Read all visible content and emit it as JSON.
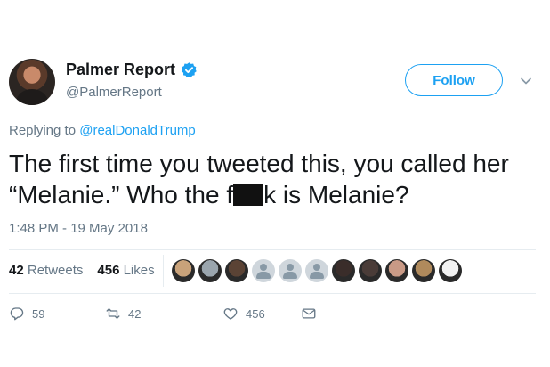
{
  "tweet": {
    "display_name": "Palmer Report",
    "handle": "@PalmerReport",
    "follow_label": "Follow",
    "reply_prefix": "Replying to",
    "reply_to": "@realDonaldTrump",
    "text_part1": "The first time you tweeted this, you called her “Melanie.” Who the f",
    "text_part2": "k is Melanie?",
    "timestamp": "1:48 PM - 19 May 2018"
  },
  "stats": {
    "retweets_count": "42",
    "retweets_label": "Retweets",
    "likes_count": "456",
    "likes_label": "Likes"
  },
  "actions": {
    "replies": "59",
    "retweets": "42",
    "likes": "456"
  },
  "likers": [
    {
      "icon": "dog-avatar",
      "color": "#c9a27a"
    },
    {
      "icon": "husky-avatar",
      "color": "#9aa5ad"
    },
    {
      "icon": "face-avatar",
      "color": "#5b4335"
    },
    {
      "icon": "default-avatar",
      "color": "#cfd6dc"
    },
    {
      "icon": "default-avatar",
      "color": "#cfd6dc"
    },
    {
      "icon": "default-avatar",
      "color": "#cfd6dc"
    },
    {
      "icon": "woman-avatar",
      "color": "#3a2d2a"
    },
    {
      "icon": "face-avatar",
      "color": "#4a3c38"
    },
    {
      "icon": "woman-avatar",
      "color": "#c99a86"
    },
    {
      "icon": "dog-avatar",
      "color": "#b08a5c"
    },
    {
      "icon": "logo-avatar",
      "color": "#f2f2f2"
    }
  ],
  "colors": {
    "accent": "#1da1f2",
    "muted": "#657786",
    "text": "#14171a"
  }
}
